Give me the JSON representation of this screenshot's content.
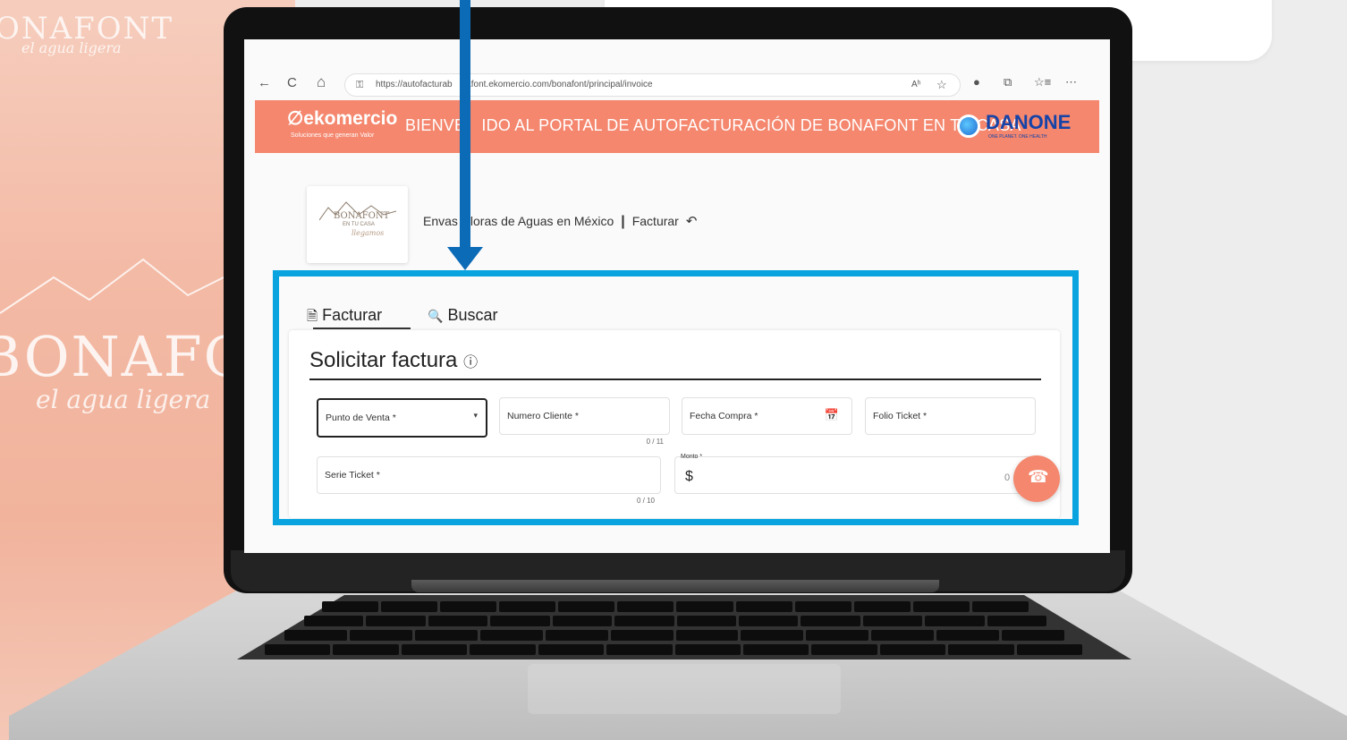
{
  "background": {
    "brand_top": "ONAFONT",
    "tagline_top": "el agua ligera",
    "brand_main": "BONAFON",
    "tagline_main": "el agua ligera"
  },
  "browser": {
    "url": "https://autofacturab nafont.ekomercio.com/bonafont/principal/invoice",
    "back_icon": "←",
    "reload_icon": "C",
    "home_icon": "⌂",
    "lock_icon": "⚿",
    "read_aloud_icon": "Aʰ",
    "favorite_icon": "☆",
    "extension_icon": "●",
    "collections_icon": "⧉",
    "favorites_bar_icon": "☆≡",
    "more_icon": "⋯"
  },
  "banner": {
    "ek_logo": "∅ekomercio",
    "ek_sub": "Soluciones que generan Valor",
    "text": "BIENVE IDO AL PORTAL DE AUTOFACTURACIÓN DE BONAFONT EN TU CASA",
    "danone": "DANONE",
    "danone_sub": "ONE PLANET. ONE HEALTH"
  },
  "logo_card": {
    "brand": "BONAFONT",
    "sub": "EN TU CASA",
    "signature": "llegamos"
  },
  "breadcrumb": {
    "company": "Envas loras de Aguas en México",
    "separator": "|",
    "page": "Facturar",
    "back_icon": "↶"
  },
  "tabs": [
    {
      "label": "Facturar",
      "icon": "🗎"
    },
    {
      "label": "Buscar",
      "icon": "🔍"
    }
  ],
  "form": {
    "title": "Solicitar factura",
    "help_icon": "ⓘ",
    "fields": {
      "punto_venta": "Punto de Venta *",
      "numero_cliente": "Numero Cliente *",
      "numero_cliente_counter": "0 / 11",
      "fecha_compra": "Fecha Compra *",
      "folio_ticket": "Folio Ticket *",
      "serie_ticket": "Serie Ticket *",
      "serie_ticket_counter": "0 / 10",
      "monto_label": "Monto *",
      "monto_prefix": "$",
      "monto_value": "0"
    },
    "calendar_icon": "📅",
    "dropdown_icon": "▾"
  },
  "fab": {
    "icon": "☎"
  },
  "highlight_color": "#09a4e0",
  "arrow_color": "#0c6bb6",
  "accent_color": "#f4876e"
}
